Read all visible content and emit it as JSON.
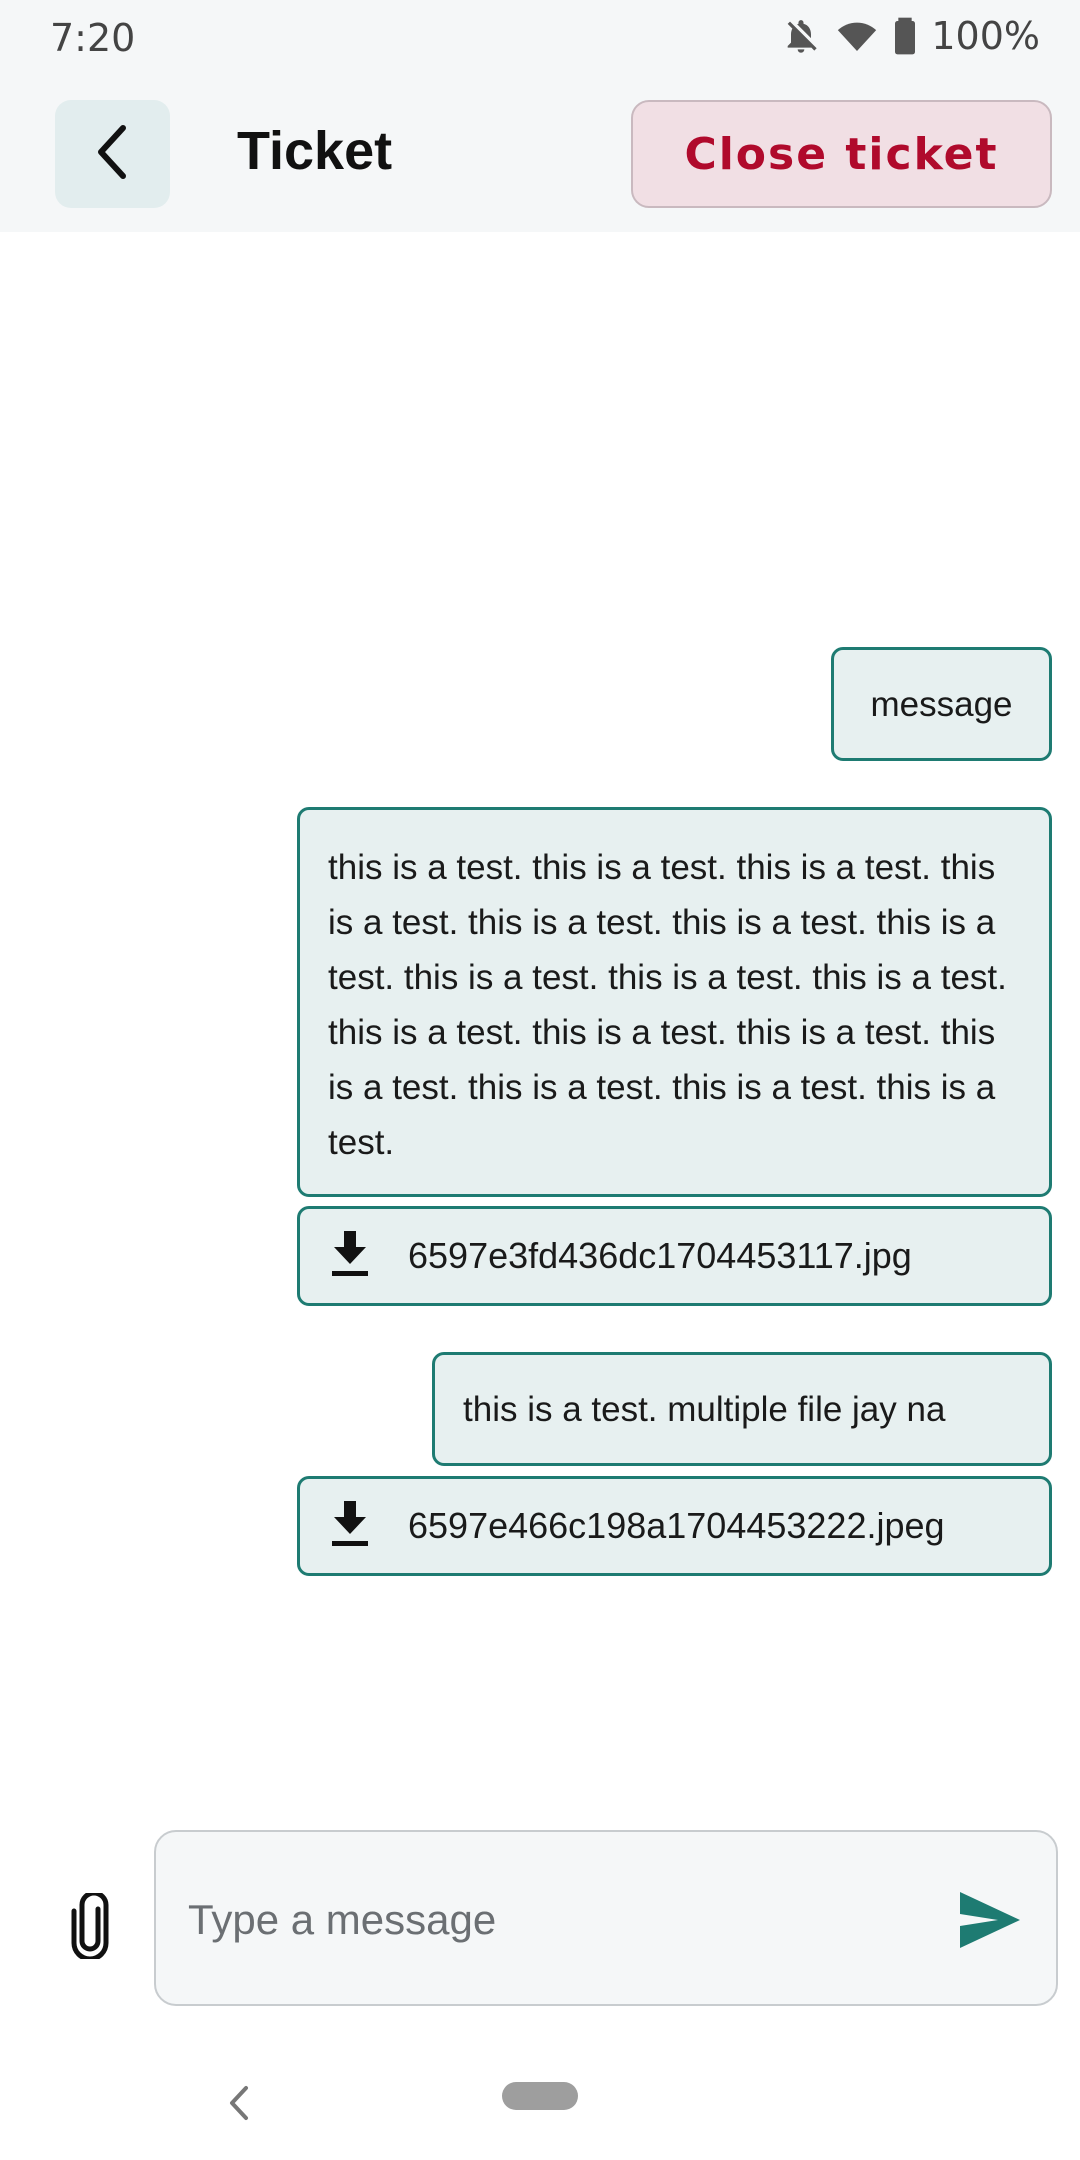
{
  "status_bar": {
    "time": "7:20",
    "battery": "100%",
    "icons": [
      "notifications-off-icon",
      "wifi-icon",
      "battery-icon"
    ]
  },
  "app_bar": {
    "back_icon": "chevron-left-icon",
    "title": "Ticket",
    "close_button_label": "Close ticket"
  },
  "messages": [
    {
      "type": "text",
      "text": "message"
    },
    {
      "type": "text",
      "text": "this is a test. this is a test. this is a test. this is a test. this is a test. this is a test. this is a test. this is a test. this is a test. this is a test. this is a test. this is a test. this is a test. this is a test. this is a test. this is a test. this is a test."
    },
    {
      "type": "file",
      "icon": "download-icon",
      "filename": "6597e3fd436dc1704453117.jpg"
    },
    {
      "type": "text",
      "text": "this is a test. multiple file jay na"
    },
    {
      "type": "file",
      "icon": "download-icon",
      "filename": "6597e466c198a1704453222.jpeg"
    }
  ],
  "composer": {
    "attach_icon": "paperclip-icon",
    "placeholder": "Type a message",
    "value": "",
    "send_icon": "send-icon"
  },
  "colors": {
    "accent": "#1e7b72",
    "bubble_bg": "#e7f0f0",
    "danger": "#b00a2c",
    "danger_bg": "#f1dfe4"
  }
}
